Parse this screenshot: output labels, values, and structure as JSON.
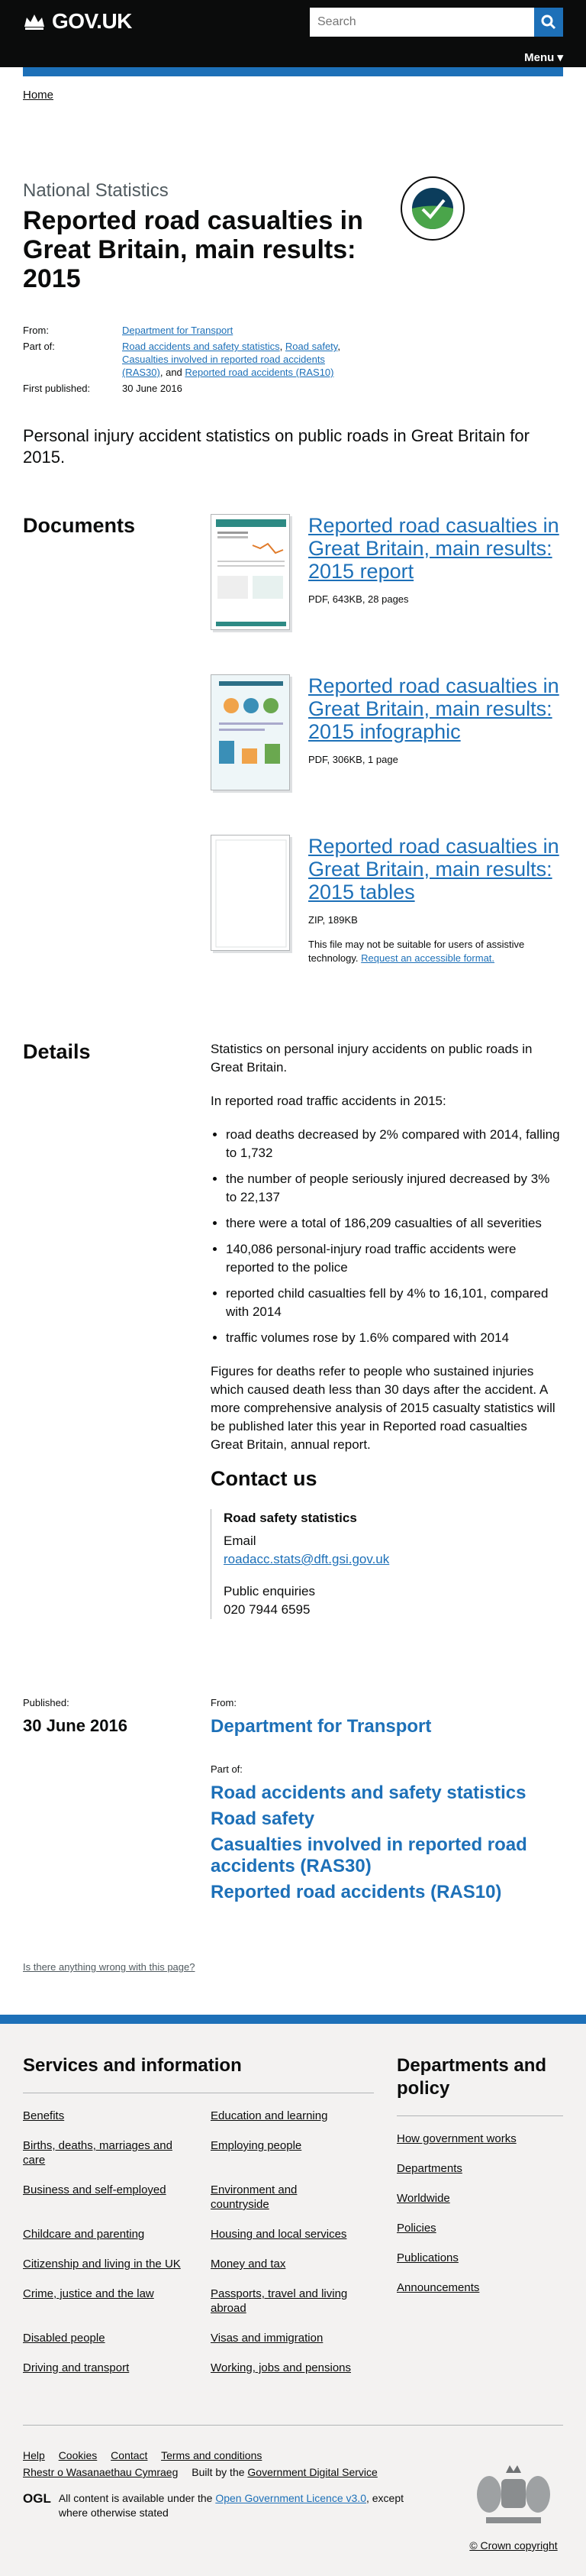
{
  "header": {
    "logo_text": "GOV.UK",
    "search_placeholder": "Search",
    "menu_label": "Menu ▾"
  },
  "breadcrumb": {
    "home": "Home"
  },
  "page": {
    "kicker": "National Statistics",
    "title": "Reported road casualties in Great Britain, main results: 2015",
    "badge_text": "NATIONAL STATISTICS"
  },
  "meta": {
    "from_label": "From:",
    "from_link": "Department for Transport",
    "part_label": "Part of:",
    "part_links": [
      "Road accidents and safety statistics",
      "Road safety",
      "Casualties involved in reported road accidents (RAS30)",
      "Reported road accidents (RAS10)"
    ],
    "part_sep1": ", ",
    "part_sep2": ", ",
    "part_sep3": ", and ",
    "published_label": "First published:",
    "published_value": "30 June 2016"
  },
  "lead": "Personal injury accident statistics on public roads in Great Britain for 2015.",
  "documents": {
    "heading": "Documents",
    "items": [
      {
        "title": "Reported road casualties in Great Britain, main results: 2015 report",
        "meta": "PDF, 643KB, 28 pages"
      },
      {
        "title": "Reported road casualties in Great Britain, main results: 2015 infographic",
        "meta": "PDF, 306KB, 1 page"
      },
      {
        "title": "Reported road casualties in Great Britain, main results: 2015 tables",
        "meta": "ZIP, 189KB",
        "note": "This file may not be suitable for users of assistive technology.",
        "note_link": "Request an accessible format."
      }
    ]
  },
  "details": {
    "heading": "Details",
    "p1": "Statistics on personal injury accidents on public roads in Great Britain.",
    "p2": "In reported road traffic accidents in 2015:",
    "bullets": [
      "road deaths decreased by 2% compared with 2014, falling to 1,732",
      "the number of people seriously injured decreased by 3% to 22,137",
      "there were a total of 186,209 casualties of all severities",
      "140,086 personal-injury road traffic accidents were reported to the police",
      "reported child casualties fell by 4% to 16,101, compared with 2014",
      "traffic volumes rose by 1.6% compared with 2014"
    ],
    "p3": "Figures for deaths refer to people who sustained injuries which caused death less than 30 days after the accident. A more comprehensive analysis of 2015 casualty statistics will be published later this year in Reported road casualties Great Britain, annual report.",
    "contact_heading": "Contact us",
    "contact_name": "Road safety statistics",
    "email_label": "Email",
    "email": "roadacc.stats@dft.gsi.gov.uk",
    "phone_label": "Public enquiries",
    "phone": "020 7944 6595"
  },
  "published": {
    "label": "Published:",
    "date": "30 June 2016",
    "from_label": "From:",
    "from": "Department for Transport",
    "part_label": "Part of:",
    "parts": [
      "Road accidents and safety statistics",
      "Road safety",
      "Casualties involved in reported road accidents (RAS30)",
      "Reported road accidents (RAS10)"
    ]
  },
  "report_link": "Is there anything wrong with this page?",
  "footer": {
    "services_heading": "Services and information",
    "services": [
      "Benefits",
      "Education and learning",
      "Births, deaths, marriages and care",
      "Employing people",
      "Business and self-employed",
      "Environment and countryside",
      "Childcare and parenting",
      "Housing and local services",
      "Citizenship and living in the UK",
      "Money and tax",
      "Crime, justice and the law",
      "Passports, travel and living abroad",
      "Disabled people",
      "Visas and immigration",
      "Driving and transport",
      "Working, jobs and pensions"
    ],
    "depts_heading": "Departments and policy",
    "depts": [
      "How government works",
      "Departments",
      "Worldwide",
      "Policies",
      "Publications",
      "Announcements"
    ],
    "bottom_links": [
      "Help",
      "Cookies",
      "Contact",
      "Terms and conditions",
      "Rhestr o Wasanaethau Cymraeg"
    ],
    "built_by": "Built by the",
    "built_by_link": "Government Digital Service",
    "ogl_mark": "OGL",
    "licence_pre": "All content is available under the",
    "licence_link": "Open Government Licence v3.0",
    "licence_post": ", except where otherwise stated",
    "copyright": "© Crown copyright"
  }
}
